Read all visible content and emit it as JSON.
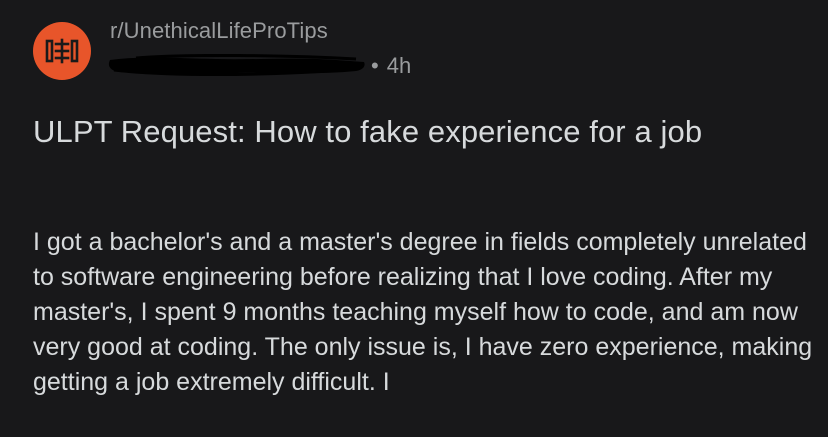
{
  "post": {
    "subreddit": "r/UnethicalLifeProTips",
    "username": "",
    "separator": "•",
    "age": "4h",
    "title": "ULPT Request: How to fake experience for a job",
    "body": "I got a bachelor's and a master's degree in fields completely unrelated to software engineering before realizing that I love coding. After my master's, I spent 9 months teaching myself how to code, and am now very good at coding. The only issue is, I have zero experience, making getting a job extremely difficult. I"
  },
  "colors": {
    "background": "#18181a",
    "subreddit_icon_bg": "#e8552a",
    "meta_text": "#9a9c9e",
    "primary_text": "#d7dadc",
    "redaction": "#000000"
  },
  "icons": {
    "subreddit_icon": "ulpt-subreddit-icon"
  }
}
